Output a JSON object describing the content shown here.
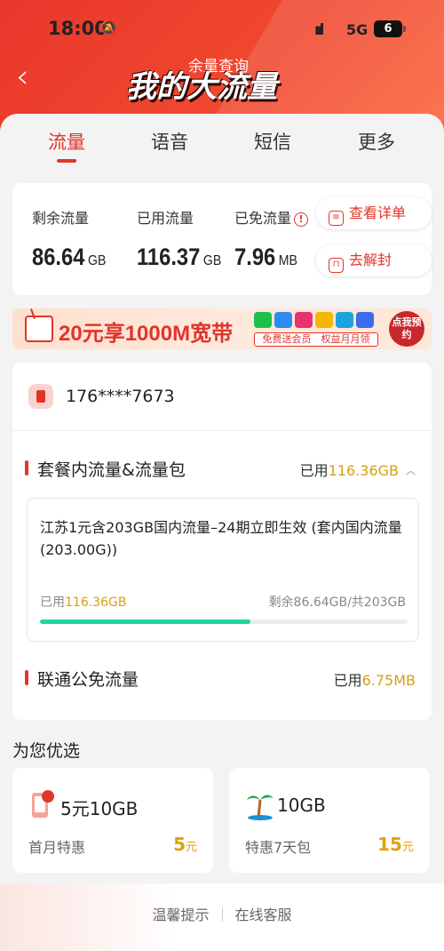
{
  "status": {
    "time": "18:00",
    "network": "5G",
    "battery": "6"
  },
  "header": {
    "subtitle": "余量查询",
    "title": "我的大流量"
  },
  "tabs": [
    "流量",
    "语音",
    "短信",
    "更多"
  ],
  "usage": {
    "remaining": {
      "label": "剩余流量",
      "value": "86.64",
      "unit": "GB"
    },
    "used": {
      "label": "已用流量",
      "value": "116.37",
      "unit": "GB"
    },
    "free": {
      "label": "已免流量",
      "value": "7.96",
      "unit": "MB"
    },
    "details_button": "查看详单",
    "unlock_button": "去解封"
  },
  "banner": {
    "title": "20元享1000M宽带",
    "subtitle": "免费送会员　权益月月领",
    "button": "点我预约"
  },
  "account": {
    "phone": "176****7673"
  },
  "package_section": {
    "title": "套餐内流量&流量包",
    "used_prefix": "已用",
    "used_value": "116.36GB",
    "package": {
      "name": "江苏1元含203GB国内流量–24期立即生效 (套内国内流量(203.00G))",
      "used_prefix": "已用",
      "used_value": "116.36GB",
      "remaining_text": "剩余86.64GB/共203GB",
      "progress_fraction": 0.573
    }
  },
  "free_section": {
    "title": "联通公免流量",
    "used_prefix": "已用",
    "used_value": "6.75MB"
  },
  "recommendations": {
    "title": "为您优选",
    "items": [
      {
        "name": "5元10GB",
        "desc": "首月特惠",
        "price": "5",
        "unit": "元"
      },
      {
        "name": "10GB",
        "desc": "特惠7天包",
        "price": "15",
        "unit": "元"
      }
    ]
  },
  "footer": {
    "tips": "温馨提示",
    "service": "在线客服"
  },
  "colors": {
    "brand": "#e0352b",
    "accent": "#d4a017",
    "progress": "#20d4a0"
  }
}
